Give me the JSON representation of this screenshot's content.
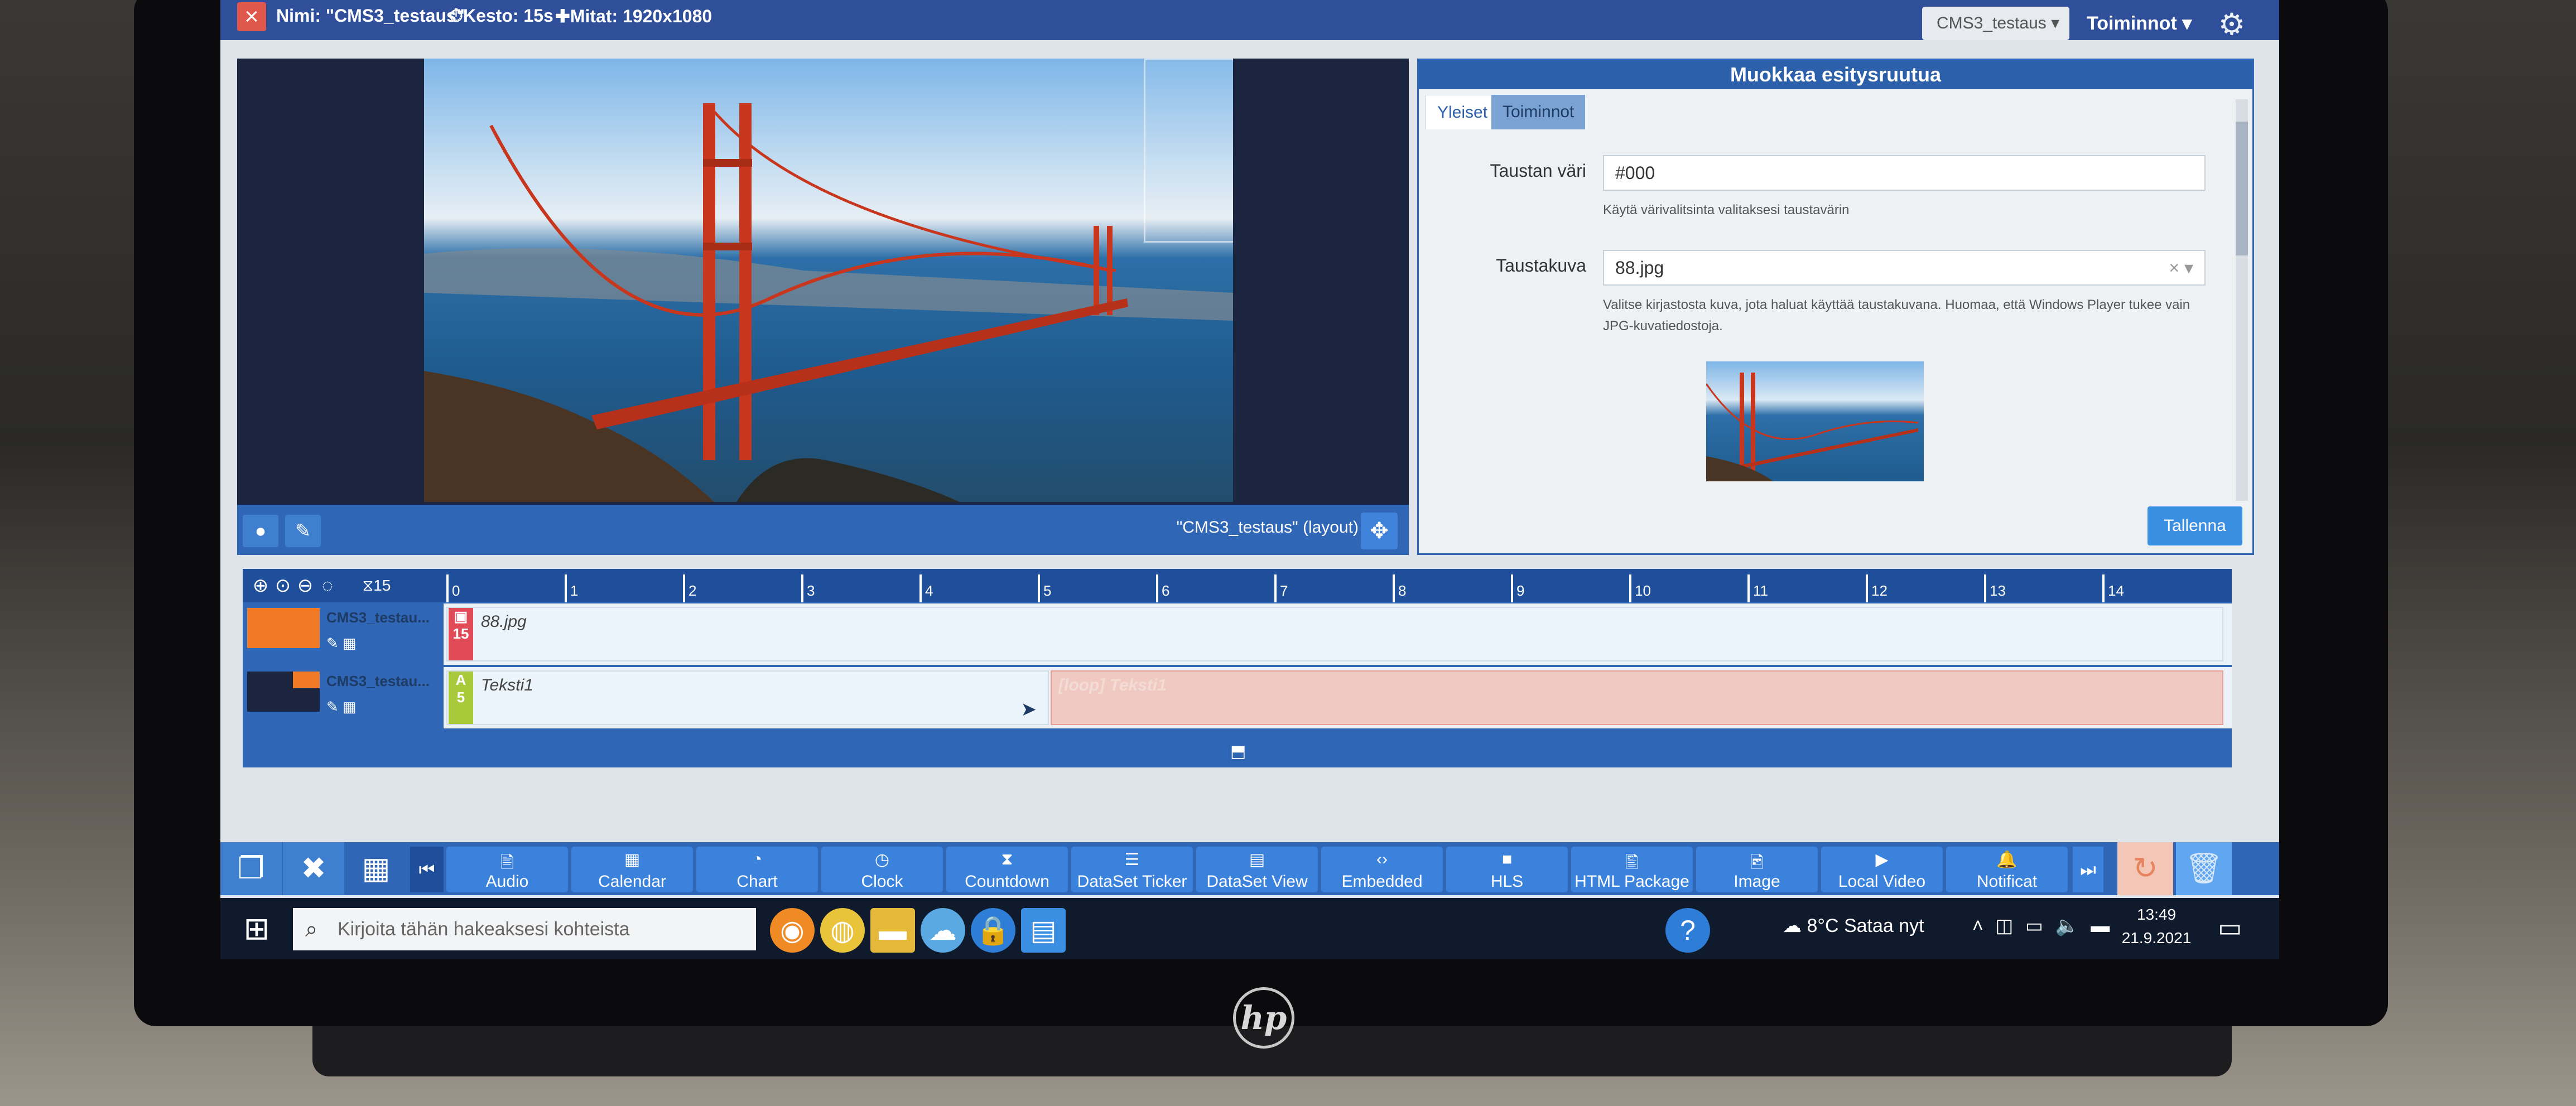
{
  "topbar": {
    "name_meta": "Nimi: \"CMS3_testaus\"",
    "duration_meta": "Kesto: 15s",
    "size_meta": "Mitat: 1920x1080",
    "layout_select": "CMS3_testaus",
    "actions_menu": "Toiminnot"
  },
  "preview": {
    "caption": "\"CMS3_testaus\" (layout)"
  },
  "props": {
    "title": "Muokkaa esitysruutua",
    "tabs": [
      "Yleiset",
      "Toiminnot"
    ],
    "bg_color_label": "Taustan väri",
    "bg_color_value": "#000",
    "bg_color_help": "Käytä värivalitsinta valitaksesi taustavärin",
    "bg_image_label": "Taustakuva",
    "bg_image_value": "88.jpg",
    "bg_image_help": "Valitse kirjastosta kuva, jota haluat käyttää taustakuvana. Huomaa, että Windows Player tukee vain JPG-kuvatiedostoja.",
    "save_label": "Tallenna"
  },
  "timeline": {
    "zoom_value": "15",
    "ticks": [
      "0",
      "1",
      "2",
      "3",
      "4",
      "5",
      "6",
      "7",
      "8",
      "9",
      "10",
      "11",
      "12",
      "13",
      "14"
    ],
    "tracks": [
      {
        "name": "CMS3_testau...",
        "badge": "15",
        "widget": "88.jpg",
        "swatch": "#f07a25",
        "badge_color": "#e14b57"
      },
      {
        "name": "CMS3_testau...",
        "badge": "5",
        "widget": "Teksti1",
        "swatch": "#1c2540",
        "badge_color": "#a7c93a",
        "overflow_widget": "[loop] Teksti1"
      }
    ]
  },
  "toolbar": {
    "buttons": [
      "Audio",
      "Calendar",
      "Chart",
      "Clock",
      "Countdown",
      "DataSet Ticker",
      "DataSet View",
      "Embedded",
      "HLS",
      "HTML Package",
      "Image",
      "Local Video",
      "Notificat"
    ]
  },
  "taskbar": {
    "search_placeholder": "Kirjoita tähän hakeaksesi kohteista",
    "weather": "8°C  Sataa nyt",
    "time": "13:49",
    "date": "21.9.2021"
  },
  "colors": {
    "primary": "#2f66b5",
    "header": "#2f4f9a",
    "accent_orange": "#f07a25",
    "danger": "#e0584c"
  }
}
